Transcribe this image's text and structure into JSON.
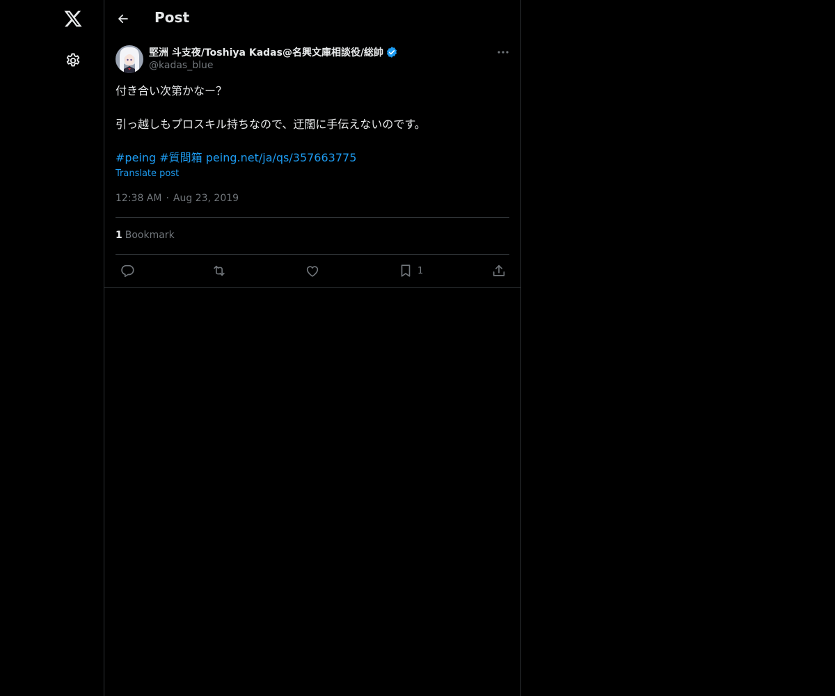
{
  "nav": {
    "logo_icon": "x-logo-icon",
    "settings_icon": "gear-icon"
  },
  "header": {
    "back_icon": "arrow-left-icon",
    "title": "Post"
  },
  "post": {
    "author": {
      "name": "堅洲 斗支夜/Toshiya Kadas@名興文庫相談役/総帥",
      "handle": "@kadas_blue",
      "verified": true
    },
    "text_line1": "付き合い次第かなー？",
    "text_line2": "引っ越しもプロスキル持ちなので、迂闊に手伝えないのです。",
    "hashtags": [
      "#peing",
      "#質問箱"
    ],
    "url": "peing.net/ja/qs/357663775",
    "translate_label": "Translate post",
    "time": "12:38 AM",
    "date": "Aug 23, 2019",
    "stats": {
      "bookmark_count": "1",
      "bookmark_label": "Bookmark"
    },
    "actions": {
      "reply_icon": "reply-icon",
      "repost_icon": "repost-icon",
      "like_icon": "heart-icon",
      "bookmark_icon": "bookmark-icon",
      "bookmark_count": "1",
      "share_icon": "share-icon"
    }
  },
  "colors": {
    "background": "#000000",
    "text_primary": "#e7e9ea",
    "text_secondary": "#71767b",
    "accent": "#1d9bf0",
    "border": "#2f3336"
  }
}
